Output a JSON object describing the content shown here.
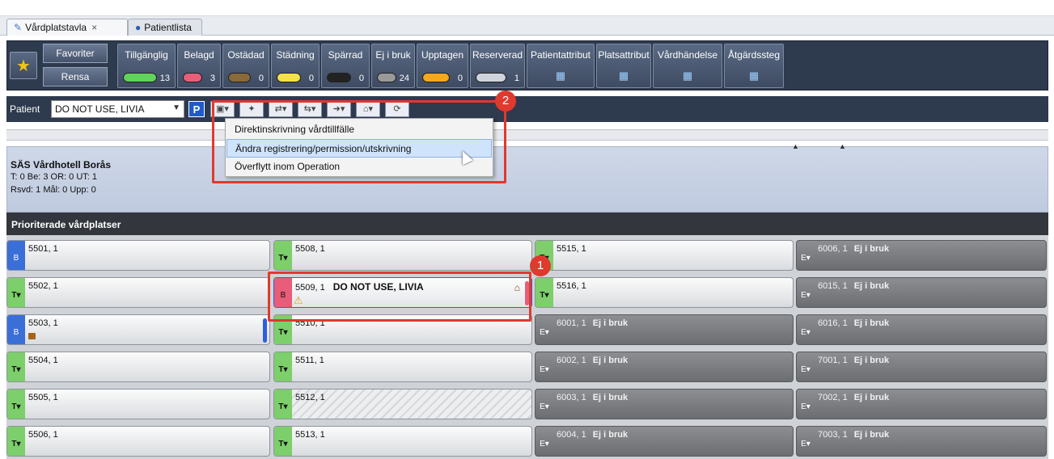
{
  "tabs": [
    {
      "label": "Vårdplatstavla",
      "close": "×",
      "icon": "wrench-icon"
    },
    {
      "label": "Patientlista",
      "icon": "person-icon"
    }
  ],
  "toolbar": {
    "favorites": "Favoriter",
    "clear": "Rensa",
    "filters": [
      {
        "label": "Tillgänglig",
        "count": "13",
        "color": "#5fd35a"
      },
      {
        "label": "Belagd",
        "count": "3",
        "color": "#e85d7a"
      },
      {
        "label": "Ostädad",
        "count": "0",
        "color": "#8a6a3a"
      },
      {
        "label": "Städning",
        "count": "0",
        "color": "#f4e04a"
      },
      {
        "label": "Spärrad",
        "count": "0",
        "color": "#222222"
      },
      {
        "label": "Ej i bruk",
        "count": "24",
        "color": "#9a9a9a"
      },
      {
        "label": "Upptagen",
        "count": "0",
        "color": "#f3a91b"
      },
      {
        "label": "Reserverad",
        "count": "1",
        "color": "#cfd4dc"
      },
      {
        "label": "Patientattribut",
        "count": "",
        "color": ""
      },
      {
        "label": "Platsattribut",
        "count": "",
        "color": ""
      },
      {
        "label": "Vårdhändelse",
        "count": "",
        "color": ""
      },
      {
        "label": "Åtgärdssteg",
        "count": "",
        "color": ""
      }
    ]
  },
  "patient": {
    "label": "Patient",
    "value": "DO NOT USE, LIVIA",
    "p_button": "P"
  },
  "menu": {
    "items": [
      "Direktinskrivning vårdtillfälle",
      "Ändra registrering/permission/utskrivning",
      "Överflytt inom Operation"
    ]
  },
  "ward": {
    "title": "SÄS Vårdhotell Borås",
    "stats1": "T: 0 Be: 3 OR: 0 UT: 1",
    "stats2": "Rsvd: 1 Mål: 0 Upp: 0"
  },
  "section": "Prioriterade vårdplatser",
  "beds": [
    {
      "id": "5501, 1",
      "status": "B"
    },
    {
      "id": "5508, 1",
      "status": "T▾"
    },
    {
      "id": "5515, 1",
      "status": "T▾"
    },
    {
      "id": "6006, 1",
      "status": "E▾",
      "note": "Ej i bruk"
    },
    {
      "id": "5502, 1",
      "status": "T▾"
    },
    {
      "id": "5509, 1",
      "status": "B",
      "patient": "DO NOT USE, LIVIA"
    },
    {
      "id": "5516, 1",
      "status": "T▾"
    },
    {
      "id": "6015, 1",
      "status": "E▾",
      "note": "Ej i bruk"
    },
    {
      "id": "5503, 1",
      "status": "B"
    },
    {
      "id": "5510, 1",
      "status": "T▾"
    },
    {
      "id": "6001, 1",
      "status": "E▾",
      "note": "Ej i bruk"
    },
    {
      "id": "6016, 1",
      "status": "E▾",
      "note": "Ej i bruk"
    },
    {
      "id": "5504, 1",
      "status": "T▾"
    },
    {
      "id": "5511, 1",
      "status": "T▾"
    },
    {
      "id": "6002, 1",
      "status": "E▾",
      "note": "Ej i bruk"
    },
    {
      "id": "7001, 1",
      "status": "E▾",
      "note": "Ej i bruk"
    },
    {
      "id": "5505, 1",
      "status": "T▾"
    },
    {
      "id": "5512, 1",
      "status": "T▾"
    },
    {
      "id": "6003, 1",
      "status": "E▾",
      "note": "Ej i bruk"
    },
    {
      "id": "7002, 1",
      "status": "E▾",
      "note": "Ej i bruk"
    },
    {
      "id": "5506, 1",
      "status": "T▾"
    },
    {
      "id": "5513, 1",
      "status": "T▾"
    },
    {
      "id": "6004, 1",
      "status": "E▾",
      "note": "Ej i bruk"
    },
    {
      "id": "7003, 1",
      "status": "E▾",
      "note": "Ej i bruk"
    }
  ],
  "annotations": [
    "1",
    "2"
  ]
}
